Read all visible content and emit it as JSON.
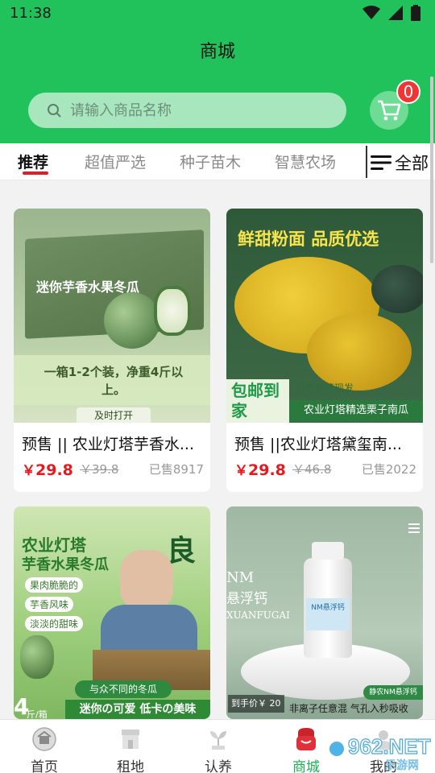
{
  "status_bar": {
    "time": "11:38"
  },
  "header": {
    "title": "商城"
  },
  "search": {
    "placeholder": "请输入商品名称"
  },
  "cart": {
    "badge_count": "0"
  },
  "tabs": [
    {
      "label": "推荐",
      "active": true
    },
    {
      "label": "超值严选",
      "active": false
    },
    {
      "label": "种子苗木",
      "active": false
    },
    {
      "label": "智慧农场",
      "active": false
    }
  ],
  "all_label": "全部",
  "products": [
    {
      "name": "预售 || 农业灯塔芋香水...",
      "currency": "￥",
      "price": "29.8",
      "old_price": "￥39.8",
      "sold": "已售8917",
      "image_text": {
        "box_title": "迷你芋香水果冬瓜",
        "caption": "一箱1-2个装，净重4斤以上。",
        "tag": "及时打开"
      }
    },
    {
      "name": "预售 ||农业灯塔黛玺南...",
      "currency": "￥",
      "price": "29.8",
      "old_price": "￥46.8",
      "sold": "已售2022",
      "image_text": {
        "headline": "鲜甜粉面 品质优选",
        "badge": "包邮到家",
        "ribbon_top": "基地现摘现发",
        "ribbon_bottom": "农业灯塔精选栗子南瓜"
      }
    },
    {
      "name": "",
      "image_text": {
        "title_1": "农业灯塔",
        "title_2": "芋香水果冬瓜",
        "points": [
          "果肉脆脆的",
          "芋香风味",
          "淡淡的甜味"
        ],
        "banner": "与众不同的冬瓜",
        "tagline": "迷你の可爱 低卡の美味",
        "weight": "4",
        "weight_unit": "斤/箱",
        "seal": "良"
      }
    },
    {
      "name": "",
      "image_text": {
        "nm_title": "NM",
        "product_cn": "悬浮钙",
        "product_pinyin": "XUANFUGAI",
        "label_mid": "NM悬浮钙",
        "price_tag": "到手价￥ 20",
        "brand_tag": "静农NM悬浮钙",
        "slogan": "非离子任意混  气孔入秒吸收"
      }
    }
  ],
  "bottom_nav": [
    {
      "label": "首页",
      "icon": "home-icon",
      "active": false
    },
    {
      "label": "租地",
      "icon": "store-icon",
      "active": false
    },
    {
      "label": "认养",
      "icon": "sprout-icon",
      "active": false
    },
    {
      "label": "商城",
      "icon": "shop-bag-icon",
      "active": true
    },
    {
      "label": "我的",
      "icon": "user-icon",
      "active": false
    }
  ],
  "watermark": {
    "text": "962.NET",
    "sub": "乐游网"
  },
  "colors": {
    "brand_green": "#21c25c",
    "price_red": "#e8191e",
    "badge_red": "#f03535",
    "active_nav": "#1fae57"
  }
}
